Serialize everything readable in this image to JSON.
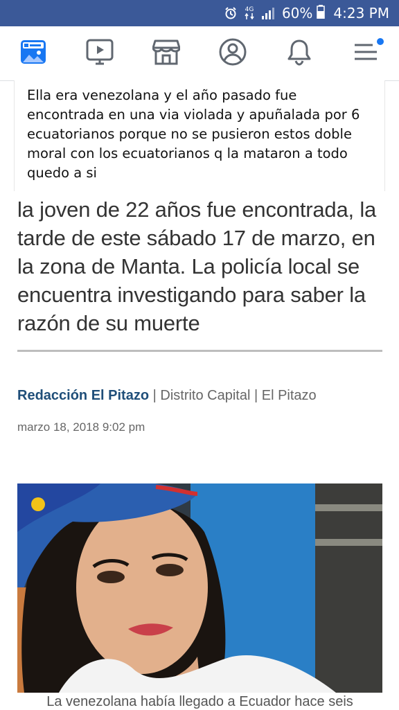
{
  "status_bar": {
    "signal": "4G",
    "battery": "60%",
    "time": "4:23 PM",
    "icons": [
      "alarm-icon",
      "data-arrows-icon",
      "signal-icon",
      "battery-icon"
    ],
    "background": "#3b5998"
  },
  "nav": {
    "items": [
      {
        "name": "news-feed",
        "icon": "news-feed-icon"
      },
      {
        "name": "watch",
        "icon": "video-icon"
      },
      {
        "name": "marketplace",
        "icon": "store-icon"
      },
      {
        "name": "profile",
        "icon": "profile-icon"
      },
      {
        "name": "notifications",
        "icon": "bell-icon"
      },
      {
        "name": "menu",
        "icon": "hamburger-menu-icon"
      }
    ],
    "active_color": "#1877f2"
  },
  "comment": {
    "text": "Ella era venezolana y el año pasado fue encontrada en una via violada y apuñalada por 6 ecuatorianos porque no se pusieron estos doble moral con los ecuatorianos q la mataron a todo quedo a si"
  },
  "article": {
    "excerpt": "la joven de 22 años fue encontrada, la tarde de este sábado 17 de marzo, en la zona de Manta. La policía local se encuentra investigando para saber la razón de su muerte",
    "author": "Redacción El Pitazo",
    "sep1": " | ",
    "section": "Distrito Capital",
    "sep2": " | ",
    "source": "El Pitazo",
    "date": "marzo 18, 2018 9:02 pm",
    "caption": "La venezolana había llegado a Ecuador hace seis"
  }
}
